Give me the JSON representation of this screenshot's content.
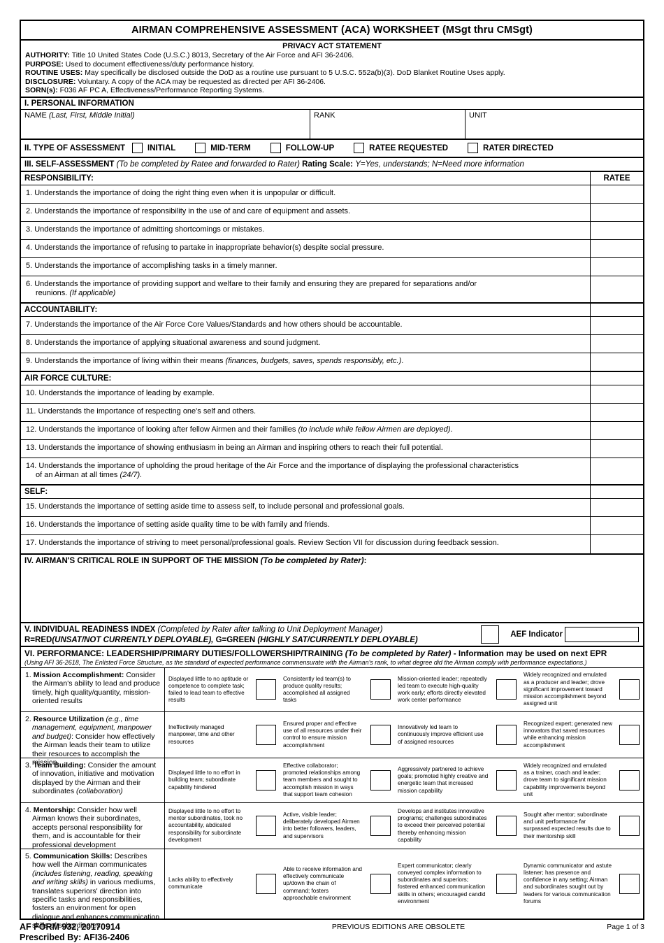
{
  "header": {
    "title": "AIRMAN COMPREHENSIVE ASSESSMENT (ACA) WORKSHEET (MSgt thru CMSgt)",
    "privacy_title": "PRIVACY ACT STATEMENT",
    "privacy": [
      {
        "label": "AUTHORITY:",
        "text": "Title 10 United States Code (U.S.C.) 8013, Secretary of the Air Force and AFI 36-2406."
      },
      {
        "label": "PURPOSE:",
        "text": "Used to document effectiveness/duty performance history."
      },
      {
        "label": "ROUTINE USES:",
        "text": "May specifically be disclosed outside the DoD as a routine use pursuant to 5 U.S.C. 552a(b)(3). DoD Blanket Routine Uses apply."
      },
      {
        "label": "DISCLOSURE:",
        "text": "Voluntary.  A copy of the ACA may be requested as directed per AFI 36-2406."
      },
      {
        "label": "SORN(s):",
        "text": "F036 AF PC A, Effectiveness/Performance Reporting Systems."
      }
    ]
  },
  "section1": {
    "heading": "I. PERSONAL INFORMATION",
    "name_label": "NAME",
    "name_hint": "(Last, First, Middle Initial)",
    "rank_label": "RANK",
    "unit_label": "UNIT",
    "name_value": "",
    "rank_value": "",
    "unit_value": ""
  },
  "section2": {
    "heading": "II. TYPE OF ASSESSMENT",
    "options": [
      "INITIAL",
      "MID-TERM",
      "FOLLOW-UP",
      "RATEE REQUESTED",
      "RATER DIRECTED"
    ]
  },
  "section3": {
    "heading": "III. SELF-ASSESSMENT",
    "heading_note": "(To be completed by Ratee and forwarded to Rater)",
    "rating_label": "Rating Scale:",
    "rating_scale": "Y=Yes, understands; N=Need more information",
    "ratee_column": "RATEE",
    "groups": [
      {
        "label": "RESPONSIBILITY:",
        "show_ratee_header": true,
        "items": [
          {
            "main": "1. Understands the importance of doing the right thing even when it is unpopular or difficult.",
            "sub": "",
            "sub_italic": ""
          },
          {
            "main": "2. Understands the importance of responsibility in the use of and care of equipment and assets.",
            "sub": "",
            "sub_italic": ""
          },
          {
            "main": "3. Understands the importance of admitting shortcomings or mistakes.",
            "sub": "",
            "sub_italic": ""
          },
          {
            "main": "4. Understands the importance of refusing to partake in inappropriate behavior(s) despite social pressure.",
            "sub": "",
            "sub_italic": ""
          },
          {
            "main": "5. Understands the importance of accomplishing tasks in a timely manner.",
            "sub": "",
            "sub_italic": ""
          },
          {
            "main": "6. Understands the importance of providing support and welfare to their family and ensuring they are prepared for separations and/or",
            "sub": "reunions. ",
            "sub_italic": "(If applicable)"
          }
        ]
      },
      {
        "label": "ACCOUNTABILITY:",
        "show_ratee_header": false,
        "items": [
          {
            "main": "7. Understands the importance of the Air Force Core Values/Standards and how others should be accountable.",
            "sub": "",
            "sub_italic": ""
          },
          {
            "main": "8. Understands the importance of applying situational awareness and sound judgment.",
            "sub": "",
            "sub_italic": ""
          },
          {
            "main": "9. Understands the importance of living within their means ",
            "sub": "",
            "sub_italic": "",
            "inline_italic": "(finances, budgets, saves, spends responsibly, etc.)",
            "tail": "."
          }
        ]
      },
      {
        "label": "AIR FORCE CULTURE:",
        "show_ratee_header": false,
        "items": [
          {
            "main": "10. Understands the importance of leading by example.",
            "sub": "",
            "sub_italic": ""
          },
          {
            "main": "11. Understands the importance of respecting one's self and others.",
            "sub": "",
            "sub_italic": ""
          },
          {
            "main": "12. Understands the importance of looking after fellow Airmen and their families ",
            "sub": "",
            "sub_italic": "",
            "inline_italic": "(to include while fellow Airmen are deployed)",
            "tail": "."
          },
          {
            "main": "13. Understands the importance of showing enthusiasm in being an Airman and inspiring others to reach their full potential.",
            "sub": "",
            "sub_italic": ""
          },
          {
            "main": "14. Understands the importance of upholding the proud heritage of the Air Force and the importance of displaying the professional characteristics",
            "sub": "of an Airman at all times ",
            "sub_italic": "(24/7)."
          }
        ]
      },
      {
        "label": "SELF:",
        "show_ratee_header": false,
        "items": [
          {
            "main": "15. Understands the importance of setting aside time to assess self, to include personal and professional goals.",
            "sub": "",
            "sub_italic": ""
          },
          {
            "main": "16. Understands the importance of setting aside quality time to be with family and friends.",
            "sub": "",
            "sub_italic": ""
          },
          {
            "main": "17. Understands the importance of striving to meet personal/professional goals. Review Section VII for discussion during feedback session.",
            "sub": "",
            "sub_italic": ""
          }
        ]
      }
    ]
  },
  "section4": {
    "heading": "IV. AIRMAN'S CRITICAL ROLE IN SUPPORT OF THE MISSION",
    "heading_note": "(To be completed by Rater)",
    "heading_tail": ":",
    "value": ""
  },
  "section5": {
    "heading": "V. INDIVIDUAL READINESS INDEX",
    "heading_note": "(Completed by Rater after talking to Unit Deployment Manager)",
    "legend_red": "R=RED",
    "legend_red_note": "(UNSAT/NOT CURRENTLY DEPLOYABLE), ",
    "legend_green": "G=GREEN",
    "legend_green_note": "(HIGHLY SAT/CURRENTLY DEPLOYABLE)",
    "index_value": "",
    "aef_label": "AEF Indicator",
    "aef_value": ""
  },
  "section6": {
    "heading": "VI. PERFORMANCE: LEADERSHIP/PRIMARY DUTIES/FOLLOWERSHIP/TRAINING",
    "heading_note": "(To be completed by Rater)",
    "heading_tail": " - Information may be used on next EPR",
    "subnote": "(Using AFI 36-2618, The Enlisted Force Structure, as the standard of expected performance commensurate with the Airman's rank, to what degree did the Airman comply with performance expectations.)",
    "rows": [
      {
        "num": "1.",
        "title_bold": "Mission Accomplishment:",
        "title_rest": " Consider the Airman's ability to lead and produce timely, high quality/quantity, mission-oriented results",
        "title_italic": "",
        "levels": [
          "Displayed little to no aptitude or competence to complete task; failed to lead team to effective results",
          "Consistently led team(s) to produce quality results; accomplished all assigned tasks",
          "Mission-oriented leader; repeatedly led team to execute high-quality work early; efforts directly elevated work center performance",
          "Widely recognized and emulated as a producer and leader; drove significant improvement toward mission accomplishment beyond assigned unit"
        ]
      },
      {
        "num": "2.",
        "title_bold": "Resource Utilization",
        "title_italic": " (e.g., time management, equipment, manpower and budget)",
        "title_rest": ": Consider how effectively the Airman leads their team to utilize their resources to accomplish the mission",
        "levels": [
          "Ineffectively managed manpower, time and other resources",
          "Ensured proper and effective use of all resources under their control to ensure mission accomplishment",
          "Innovatively led team to continuously improve efficient use of assigned resources",
          "Recognized expert; generated new innovators that saved resources while enhancing mission accomplishment"
        ]
      },
      {
        "num": "3.",
        "title_bold": "Team Building:",
        "title_rest": " Consider the amount of innovation, initiative and motivation displayed by the Airman and their subordinates ",
        "title_italic": "(collaboration)",
        "levels": [
          "Displayed little to no effort in building team; subordinate capability hindered",
          "Effective collaborator; promoted relationships among team members and sought to accomplish mission in ways that support team cohesion",
          "Aggressively partnered to achieve goals; promoted highly creative and energetic team that increased mission capability",
          "Widely recognized and emulated as a trainer, coach and leader; drove team to significant mission capability improvements beyond unit"
        ]
      },
      {
        "num": "4.",
        "title_bold": "Mentorship:",
        "title_rest": " Consider how well Airman knows their subordinates, accepts personal responsibility for them, and is accountable for their professional development",
        "title_italic": "",
        "levels": [
          "Displayed little to no effort to mentor subordinates, took no accountability, abdicated responsibility for subordinate  development",
          "Active, visible leader; deliberately developed Airmen into better followers, leaders, and supervisors",
          "Develops and institutes innovative programs; challenges subordinates to exceed their perceived potential thereby enhancing mission capability",
          "Sought after mentor; subordinate and unit performance far surpassed expected results due to their mentorship skill"
        ]
      },
      {
        "num": "5.",
        "title_bold": "Communication Skills:",
        "title_rest": " Describes how well the Airman communicates ",
        "title_italic": "(includes listening, reading, speaking and writing skills)",
        "title_rest2": " in various mediums, translates superiors' direction into specific tasks and responsibilities, fosters an environment for open dialogue and enhances communication skills of subordinates",
        "levels": [
          "Lacks ability to effectively communicate",
          "Able to receive information and effectively communicate up/down the chain of command; fosters approachable environment",
          "Expert communicator; clearly conveyed complex information to subordinates and superiors; fostered enhanced communication skills in others; encouraged candid environment",
          "Dynamic communicator and astute listener; has presence and confidence in any setting; Airman and subordinates sought out by leaders for various communication forums"
        ]
      }
    ]
  },
  "footer": {
    "form_id": "AF FORM 932, 20170914",
    "prescribed": "Prescribed By: AFI36-2406",
    "obsolete": "PREVIOUS EDITIONS ARE OBSOLETE",
    "page": "Page 1 of 3"
  }
}
